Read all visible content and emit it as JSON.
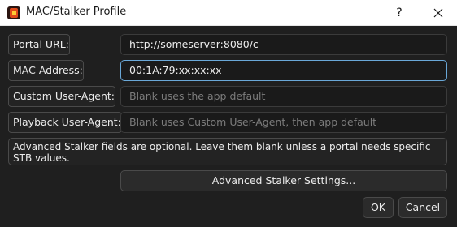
{
  "window": {
    "title": "MAC/Stalker Profile",
    "help_glyph": "?"
  },
  "fields": {
    "portal_url": {
      "label": "Portal URL:",
      "value": "http://someserver:8080/c"
    },
    "mac_address": {
      "label": "MAC Address:",
      "value": "00:1A:79:xx:xx:xx"
    },
    "custom_user_agent": {
      "label": "Custom User-Agent:",
      "placeholder": "Blank uses the app default"
    },
    "playback_user_agent": {
      "label": "Playback User-Agent:",
      "placeholder": "Blank uses Custom User-Agent, then app default"
    }
  },
  "info_text": "Advanced Stalker fields are optional. Leave them blank unless a portal needs specific STB values.",
  "buttons": {
    "advanced": "Advanced Stalker Settings...",
    "ok": "OK",
    "cancel": "Cancel"
  },
  "icons": {
    "app": "app-logo-icon",
    "help": "help-icon",
    "close": "close-icon"
  },
  "colors": {
    "dialog_bg": "#1f1f1f",
    "focus_border": "#6aa8d8",
    "placeholder": "#7c7c7c"
  }
}
